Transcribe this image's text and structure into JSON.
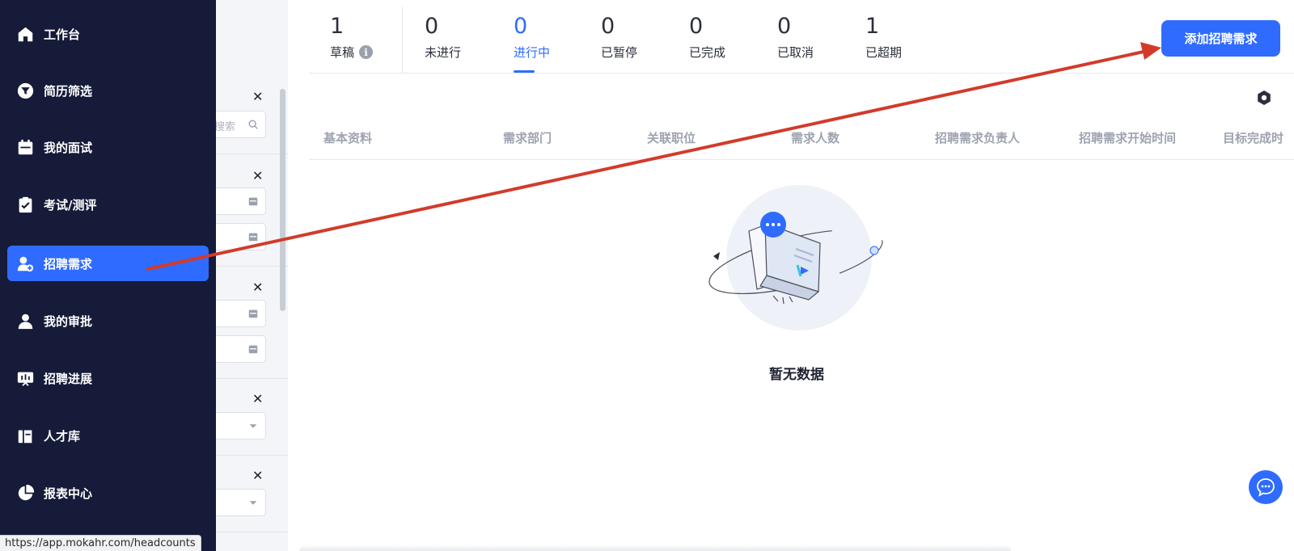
{
  "sidebar": {
    "items": [
      {
        "label": "工作台",
        "icon": "home-icon"
      },
      {
        "label": "简历筛选",
        "icon": "filter-icon"
      },
      {
        "label": "我的面试",
        "icon": "calendar-icon"
      },
      {
        "label": "考试/测评",
        "icon": "clipboard-icon"
      },
      {
        "label": "招聘需求",
        "icon": "add-user-icon",
        "active": true
      },
      {
        "label": "我的审批",
        "icon": "person-icon"
      },
      {
        "label": "招聘进展",
        "icon": "presentation-icon"
      },
      {
        "label": "人才库",
        "icon": "book-icon"
      },
      {
        "label": "报表中心",
        "icon": "pie-chart-icon"
      }
    ]
  },
  "filter": {
    "search_placeholder": "搜索"
  },
  "tabs": [
    {
      "count": "1",
      "label": "草稿"
    },
    {
      "count": "0",
      "label": "未进行"
    },
    {
      "count": "0",
      "label": "进行中",
      "active": true
    },
    {
      "count": "0",
      "label": "已暂停"
    },
    {
      "count": "0",
      "label": "已完成"
    },
    {
      "count": "0",
      "label": "已取消"
    },
    {
      "count": "1",
      "label": "已超期"
    }
  ],
  "add_button": "添加招聘需求",
  "table": {
    "columns": [
      "基本资料",
      "需求部门",
      "关联职位",
      "需求人数",
      "招聘需求负责人",
      "招聘需求开始时间",
      "目标完成时"
    ]
  },
  "empty_text": "暂无数据",
  "status_url": "https://app.mokahr.com/headcounts",
  "colors": {
    "sidebar_bg": "#151b38",
    "accent": "#2f6bff",
    "annotation_arrow": "#d23b2a"
  }
}
